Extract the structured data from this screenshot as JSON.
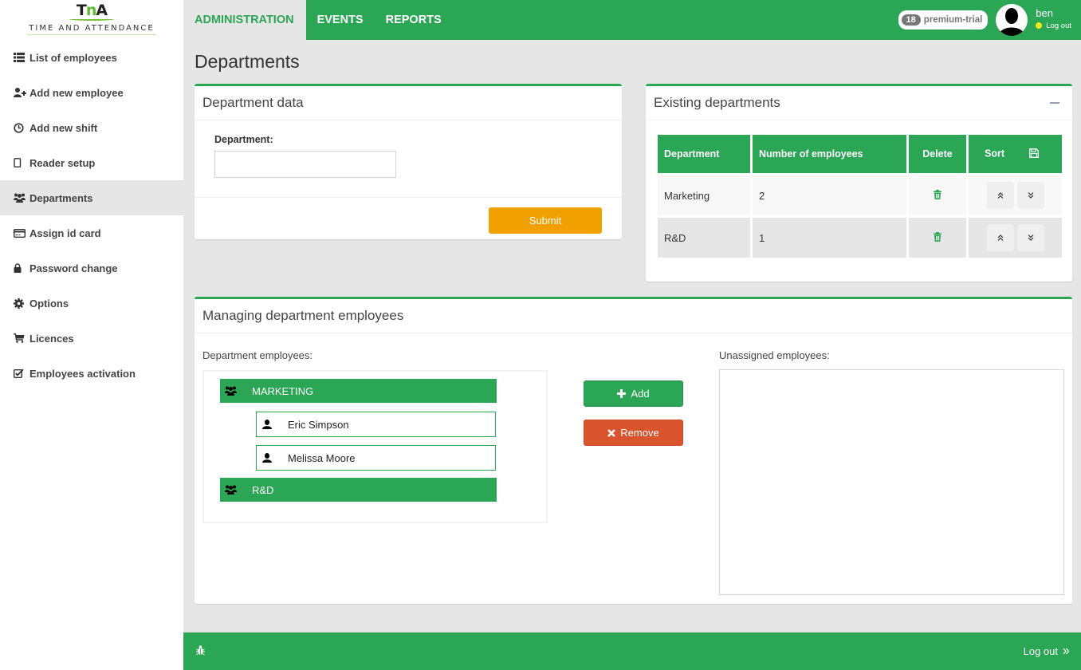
{
  "app": {
    "logo_mark": "TnA",
    "logo_text": "TIME AND ATTENDANCE"
  },
  "sidebar": {
    "items": [
      {
        "label": "List of employees",
        "icon": "list-icon",
        "active": false
      },
      {
        "label": "Add new employee",
        "icon": "user-plus-icon",
        "active": false
      },
      {
        "label": "Add new shift",
        "icon": "clock-icon",
        "active": false
      },
      {
        "label": "Reader setup",
        "icon": "tablet-icon",
        "active": false
      },
      {
        "label": "Departments",
        "icon": "users-icon",
        "active": true
      },
      {
        "label": "Assign id card",
        "icon": "credit-card-icon",
        "active": false
      },
      {
        "label": "Password change",
        "icon": "lock-icon",
        "active": false
      },
      {
        "label": "Options",
        "icon": "gear-icon",
        "active": false
      },
      {
        "label": "Licences",
        "icon": "cart-icon",
        "active": false
      },
      {
        "label": "Employees activation",
        "icon": "check-square-icon",
        "active": false
      }
    ]
  },
  "topbar": {
    "tabs": [
      {
        "label": "ADMINISTRATION",
        "active": true
      },
      {
        "label": "EVENTS",
        "active": false
      },
      {
        "label": "REPORTS",
        "active": false
      }
    ],
    "licence_days": "18",
    "licence_label": "premium-trial",
    "user_name": "ben",
    "user_logout": "Log out",
    "status_color": "#f0e81c"
  },
  "page": {
    "title": "Departments"
  },
  "department_data": {
    "title": "Department data",
    "field_label": "Department:",
    "field_value": "",
    "submit_label": "Submit"
  },
  "existing_departments": {
    "title": "Existing departments",
    "columns": [
      "Department",
      "Number of employees",
      "Delete",
      "Sort"
    ],
    "rows": [
      {
        "department": "Marketing",
        "employees": "2"
      },
      {
        "department": "R&D",
        "employees": "1"
      }
    ]
  },
  "managing": {
    "title": "Managing department employees",
    "department_employees_label": "Department employees:",
    "unassigned_label": "Unassigned employees:",
    "tree": [
      {
        "department": "MARKETING",
        "employees": [
          "Eric Simpson",
          "Melissa Moore"
        ]
      },
      {
        "department": "R&D",
        "employees": []
      }
    ],
    "add_label": "Add",
    "remove_label": "Remove",
    "unassigned_employees": []
  },
  "footer": {
    "logout_label": "Log out"
  },
  "colors": {
    "brand_green": "#2ba655",
    "submit_orange": "#f0a000",
    "remove_red": "#d9532d"
  }
}
